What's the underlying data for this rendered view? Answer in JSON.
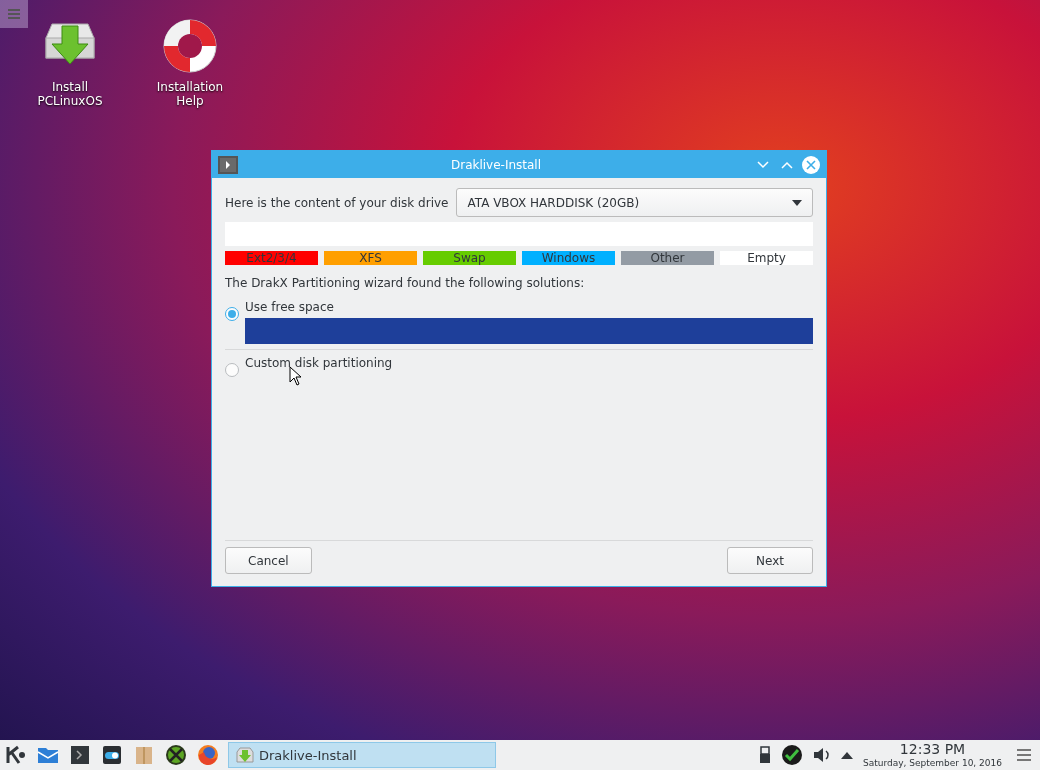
{
  "desktop_icons": [
    {
      "kind": "install",
      "label": "Install PCLinuxOS"
    },
    {
      "kind": "help",
      "label": "Installation Help"
    }
  ],
  "window": {
    "title": "Draklive-Install",
    "disk_label": "Here is the content of your disk drive",
    "disk_select": {
      "value": "ATA VBOX HARDDISK (20GB)"
    },
    "legend": [
      {
        "label": "Ext2/3/4",
        "color": "#ff0000"
      },
      {
        "label": "XFS",
        "color": "#ff9f00"
      },
      {
        "label": "Swap",
        "color": "#66cc00"
      },
      {
        "label": "Windows",
        "color": "#00b0ff"
      },
      {
        "label": "Other",
        "color": "#939ba4"
      },
      {
        "label": "Empty",
        "color": "#ffffff"
      }
    ],
    "solutions_label": "The DrakX Partitioning wizard found the following solutions:",
    "solutions": [
      {
        "kind": "bar",
        "label": "Use free space",
        "selected": true,
        "color": "#1e3f9a"
      },
      {
        "kind": "plain",
        "label": "Custom disk partitioning",
        "selected": false
      }
    ],
    "buttons": [
      "Cancel",
      "Next"
    ]
  },
  "taskbar": {
    "launchers": [
      {
        "kind": "kde"
      },
      {
        "kind": "mail"
      },
      {
        "kind": "terminal"
      },
      {
        "kind": "settings"
      },
      {
        "kind": "package"
      },
      {
        "kind": "tools"
      },
      {
        "kind": "firefox"
      }
    ],
    "task": {
      "label": "Draklive-Install",
      "selected": true
    },
    "time": "12:33 PM",
    "date": "Saturday, September 10, 2016"
  }
}
